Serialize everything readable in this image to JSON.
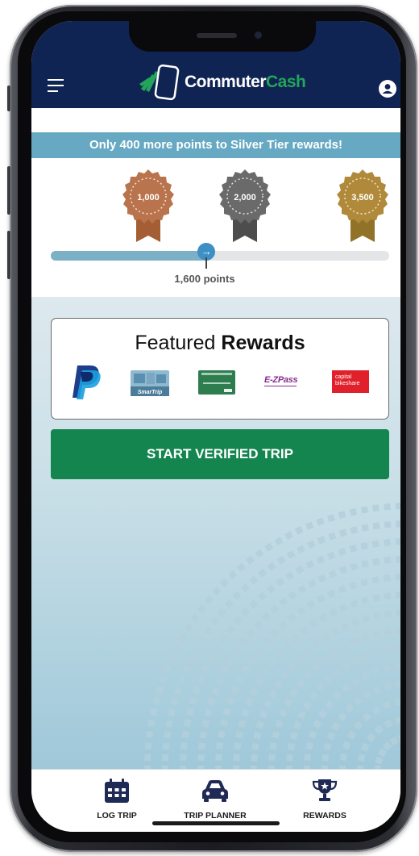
{
  "app": {
    "brand_part1": "Commuter",
    "brand_part2": "Cash"
  },
  "tier_banner": "Only 400 more points to Silver Tier rewards!",
  "tiers": [
    {
      "label": "1,000",
      "color": "#b9744e"
    },
    {
      "label": "2,000",
      "color": "#6a6a6a"
    },
    {
      "label": "3,500",
      "color": "#b08a3a"
    }
  ],
  "progress": {
    "points_label": "1,600 points",
    "fraction": 0.46
  },
  "featured": {
    "title_regular": "Featured",
    "title_bold": "Rewards",
    "logos": [
      "paypal-logo",
      "smartrip-card",
      "commuter-connections-card",
      "ezpass-logo",
      "capital-bikeshare-logo"
    ],
    "ezpass_text": "E-ZPass",
    "bikeshare_text_1": "capital",
    "bikeshare_text_2": "bikeshare"
  },
  "start_trip_label": "START VERIFIED TRIP",
  "nav": [
    {
      "label": "LOG TRIP",
      "icon": "calendar-icon"
    },
    {
      "label": "TRIP PLANNER",
      "icon": "car-icon"
    },
    {
      "label": "REWARDS",
      "icon": "trophy-icon"
    }
  ],
  "colors": {
    "header": "#0f2453",
    "banner": "#67a9c2",
    "primary_button": "#14854f",
    "brand_green": "#22a55a"
  }
}
